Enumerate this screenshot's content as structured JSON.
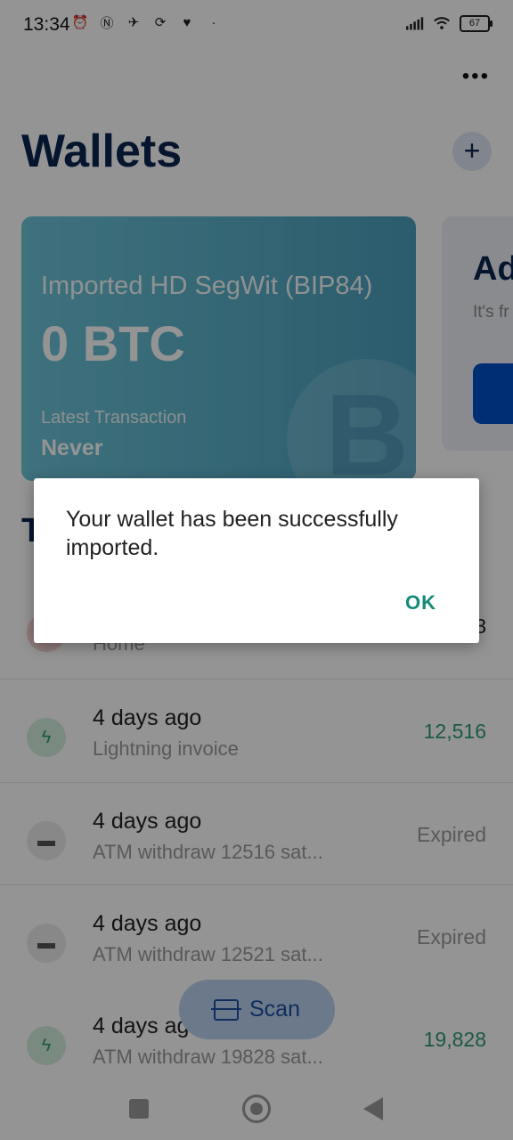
{
  "status_bar": {
    "time": "13:34",
    "battery": "67",
    "left_icons": [
      "alarm-icon",
      "nfc-icon",
      "bird-icon",
      "sync-icon",
      "health-icon",
      "dot-icon"
    ],
    "right_icons": [
      "signal-icon",
      "wifi-icon",
      "battery-icon"
    ]
  },
  "header": {
    "more_label": "•••",
    "title": "Wallets",
    "add_label": "+"
  },
  "wallet_card": {
    "label": "Imported HD SegWit (BIP84)",
    "balance": "0 BTC",
    "latest_tx_label": "Latest Transaction",
    "latest_tx_value": "Never",
    "coin_glyph": "B",
    "gradient_start": "#6cc4d8",
    "gradient_end": "#4b9fbd"
  },
  "add_wallet_card": {
    "title": "Ad",
    "text": "It's fr as m"
  },
  "transactions": {
    "header": "T",
    "items": [
      {
        "date": "",
        "memo": "Home",
        "amount": "3",
        "icon": "home-icon",
        "status": "partially-hidden"
      },
      {
        "date": "4 days ago",
        "memo": "Lightning invoice",
        "amount": "12,516",
        "icon": "lightning-icon",
        "color": "#2f9a73"
      },
      {
        "date": "4 days ago",
        "memo": "ATM withdraw 12516 sat...",
        "amount": "Expired",
        "icon": "folder-icon",
        "color": "#9a9a9a"
      },
      {
        "date": "4 days ago",
        "memo": "ATM withdraw 12521 sat...",
        "amount": "Expired",
        "icon": "folder-icon",
        "color": "#9a9a9a"
      },
      {
        "date": "4 days ago",
        "memo": "ATM withdraw 19828 sat...",
        "amount": "19,828",
        "icon": "lightning-icon",
        "color": "#2f9a73"
      }
    ]
  },
  "scan_button": {
    "label": "Scan"
  },
  "dialog": {
    "message": "Your wallet has been successfully imported.",
    "ok_label": "OK"
  },
  "colors": {
    "title": "#0c2550",
    "accent": "#0050c8",
    "positive": "#2f9a73",
    "dialog_button": "#138a7a"
  }
}
